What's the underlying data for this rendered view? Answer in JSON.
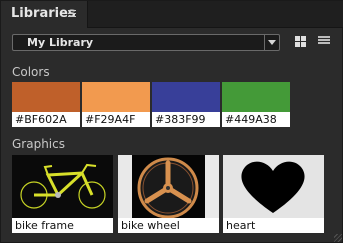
{
  "panel": {
    "tab_title": "Libraries",
    "library_selected": "My Library"
  },
  "sections": {
    "colors_title": "Colors",
    "graphics_title": "Graphics"
  },
  "colors": [
    {
      "label": "#BF602A",
      "hex": "#BF602A"
    },
    {
      "label": "#F29A4F",
      "hex": "#F29A4F"
    },
    {
      "label": "#383F99",
      "hex": "#383F99"
    },
    {
      "label": "#449A38",
      "hex": "#449A38"
    }
  ],
  "graphics": [
    {
      "label": "bike frame",
      "icon": "bike-frame-image"
    },
    {
      "label": "bike wheel",
      "icon": "bike-wheel-image"
    },
    {
      "label": "heart",
      "icon": "heart-shape"
    }
  ],
  "icons": {
    "panel_menu": "hamburger-icon",
    "dropdown": "chevron-down-icon",
    "grid_view": "grid-icon",
    "list_view": "list-icon"
  }
}
